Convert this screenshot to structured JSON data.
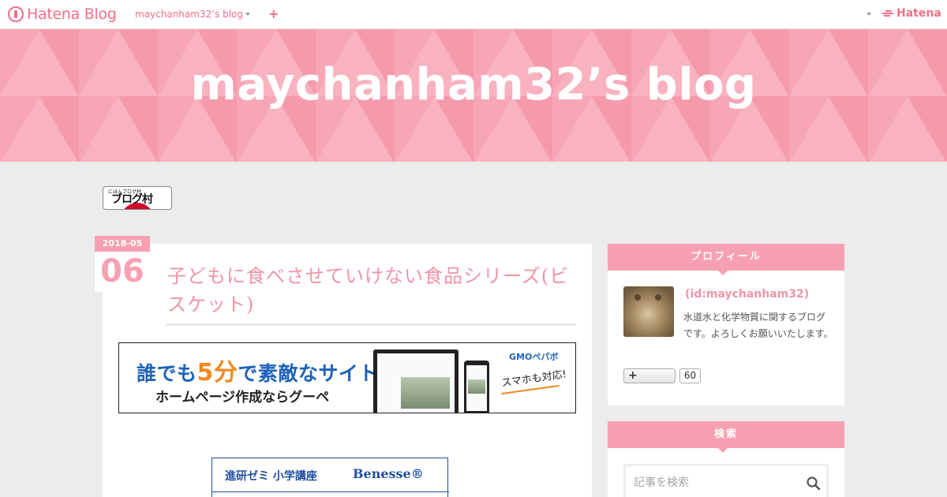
{
  "globalbar": {
    "brand": "Hatena Blog",
    "blog_switch": "maychanham32’s blog",
    "add_label": "+",
    "right_logo": "Hatena"
  },
  "header": {
    "title": "maychanham32’s blog"
  },
  "blogmura": {
    "small": "にほんブログ村",
    "label": "ブログ村"
  },
  "entry": {
    "date_ym": "2018-05",
    "date_day": "06",
    "title": "子どもに食べさせていけない食品シリーズ(ビスケット)"
  },
  "ads": {
    "ad1": {
      "head_pre": "誰でも",
      "head_num": "5分",
      "head_post": "で素敵なサイト",
      "sub": "ホームページ作成ならグーペ",
      "brand": "GMOペパボ",
      "note": "スマホも対応!"
    },
    "ad2": {
      "text": "進研ゼミ 小学講座",
      "logo": "Benesse®"
    }
  },
  "sidebar": {
    "profile": {
      "heading": "プロフィール",
      "id": "(id:maychanham32)",
      "description": "水道水と化学物質に関するブログです。よろしくお願いいたします。",
      "follow_label": "+",
      "follow_count": "60"
    },
    "search": {
      "heading": "検索",
      "placeholder": "記事を検索"
    }
  },
  "colors": {
    "accent": "#f7a0b1",
    "title_pink": "#f094a6",
    "brand_pink": "#f16e86"
  }
}
